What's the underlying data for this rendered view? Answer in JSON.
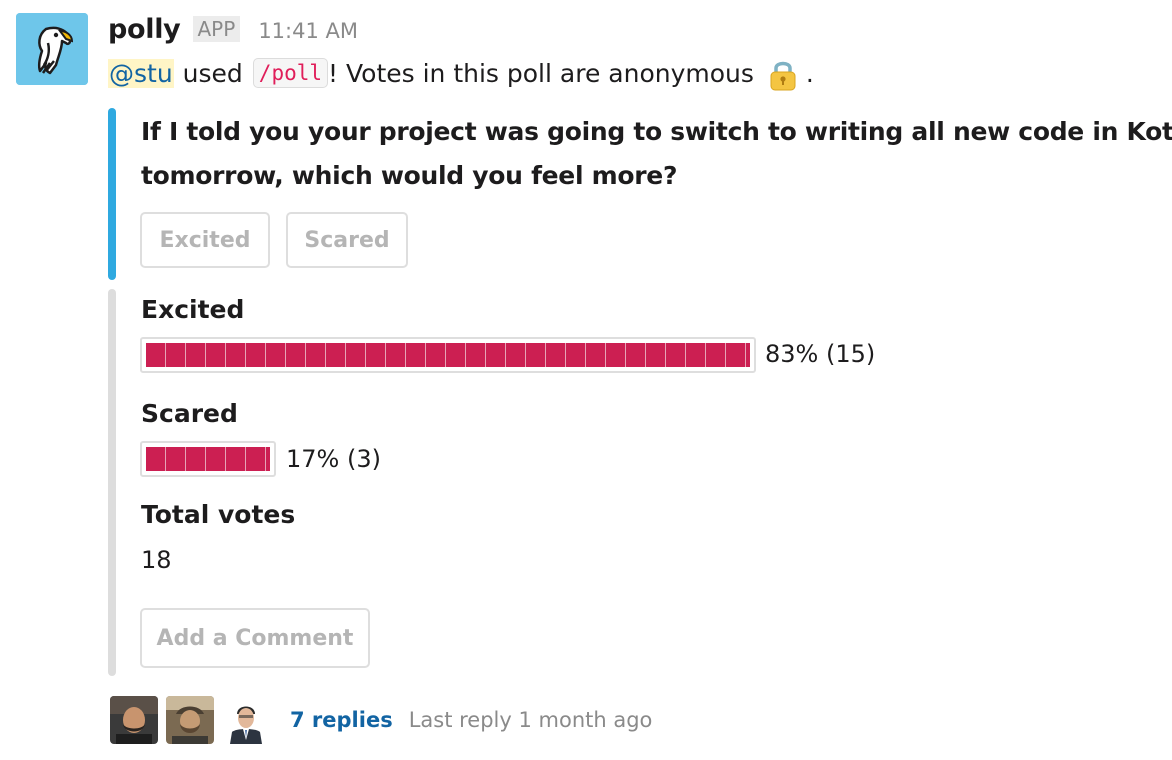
{
  "message": {
    "app_name": "polly",
    "app_badge": "APP",
    "timestamp": "11:41 AM",
    "intro": {
      "mention": "@stu",
      "used": "used",
      "command": "/poll",
      "text": "! Votes in this poll are anonymous",
      "lock_icon": "lock-icon",
      "dot": "."
    }
  },
  "poll": {
    "question": [
      "If I told you your project was going to switch to writing all new code in Kotlin",
      "tomorrow, which would you feel more?"
    ],
    "buttons": [
      "Excited",
      "Scared"
    ],
    "options": [
      {
        "label": "Excited",
        "result": "83% (15)",
        "percent": 83
      },
      {
        "label": "Scared",
        "result": "17% (3)",
        "percent": 17
      }
    ],
    "total_label": "Total votes",
    "total_value": "18",
    "comment_button": "Add a Comment"
  },
  "thread": {
    "replies": "7 replies",
    "last_reply": "Last reply 1 month ago"
  },
  "colors": {
    "accent_blue": "#2fa9e0",
    "bar_fill": "#cc1f52",
    "link": "#1264a3"
  }
}
